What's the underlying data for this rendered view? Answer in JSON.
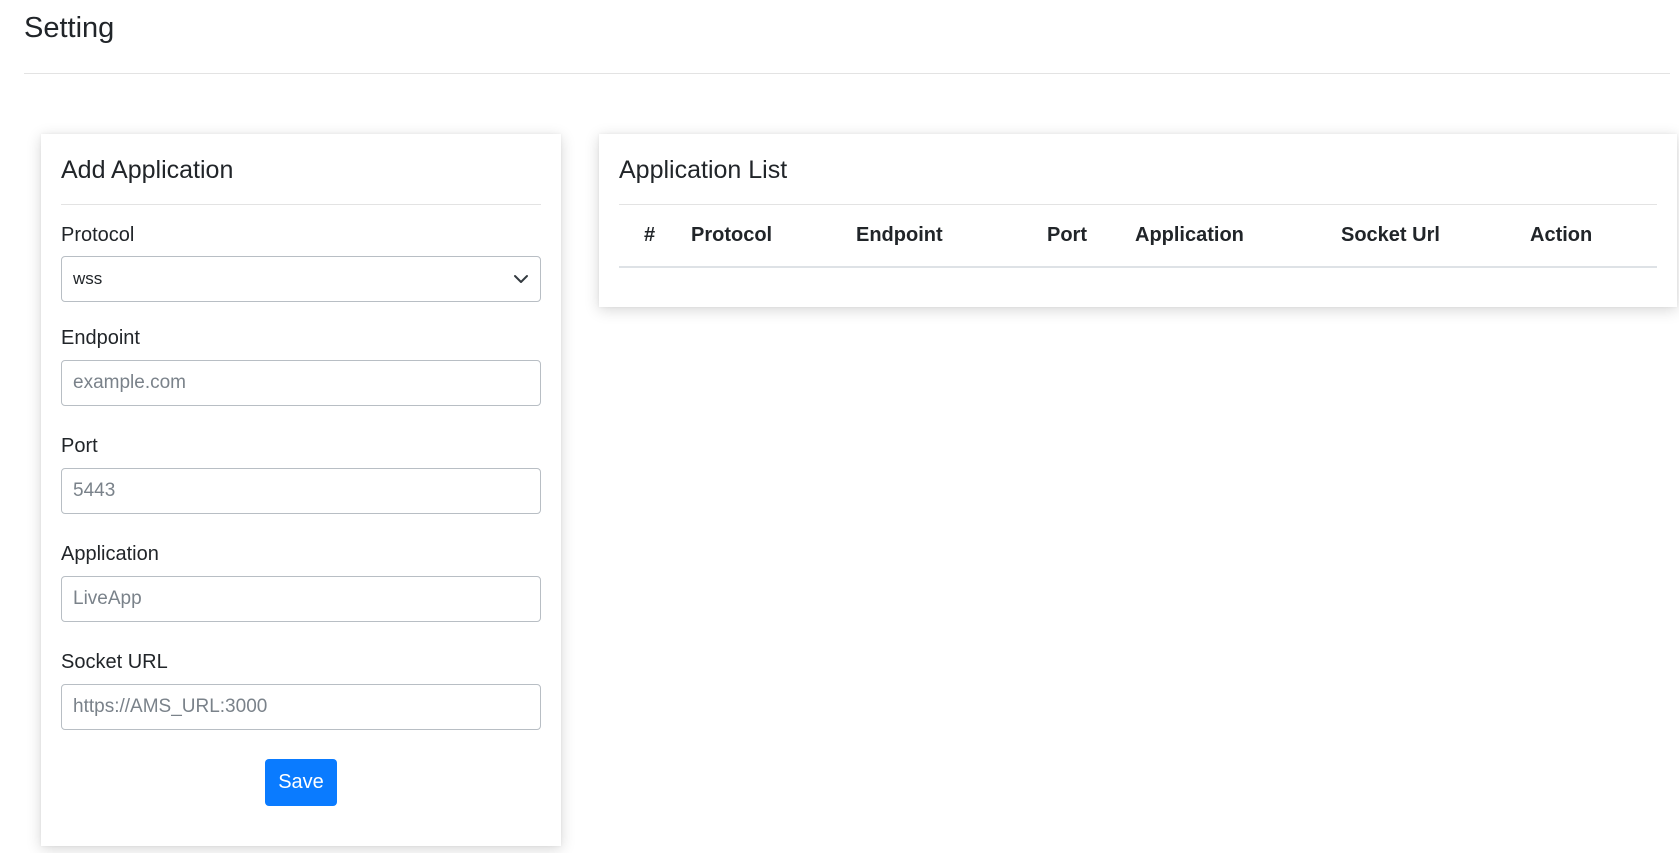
{
  "page": {
    "title": "Setting"
  },
  "add_form": {
    "title": "Add Application",
    "fields": {
      "protocol": {
        "label": "Protocol",
        "value": "wss"
      },
      "endpoint": {
        "label": "Endpoint",
        "placeholder": "example.com",
        "value": ""
      },
      "port": {
        "label": "Port",
        "placeholder": "5443",
        "value": ""
      },
      "application": {
        "label": "Application",
        "placeholder": "LiveApp",
        "value": ""
      },
      "socket_url": {
        "label": "Socket URL",
        "placeholder": "https://AMS_URL:3000",
        "value": ""
      }
    },
    "save_label": "Save",
    "accent_color": "#0a7bff"
  },
  "app_list": {
    "title": "Application List",
    "columns": [
      "#",
      "Protocol",
      "Endpoint",
      "Port",
      "Application",
      "Socket Url",
      "Action"
    ],
    "rows": []
  }
}
